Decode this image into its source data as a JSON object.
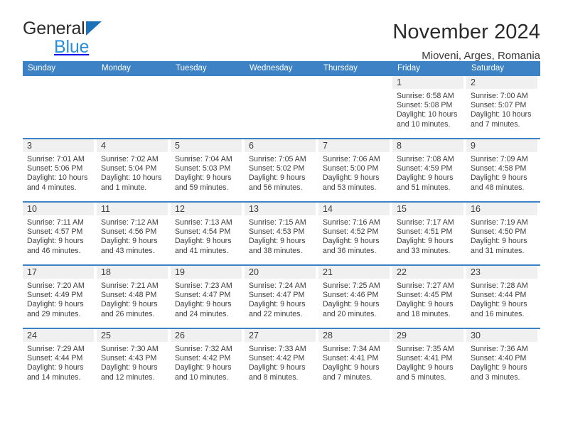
{
  "brand": {
    "name_part1": "General",
    "name_part2": "Blue",
    "logo_icon": "triangle-logo-icon"
  },
  "header": {
    "title": "November 2024",
    "subtitle": "Mioveni, Arges, Romania"
  },
  "calendar": {
    "weekday_headers": [
      "Sunday",
      "Monday",
      "Tuesday",
      "Wednesday",
      "Thursday",
      "Friday",
      "Saturday"
    ],
    "colors": {
      "header_blue": "#3c82c4",
      "daynum_band": "#f0f0f0",
      "brand_blue": "#2a8fd8",
      "logo_blue": "#1b72b8"
    },
    "weeks": [
      [
        {
          "day": "",
          "lines": []
        },
        {
          "day": "",
          "lines": []
        },
        {
          "day": "",
          "lines": []
        },
        {
          "day": "",
          "lines": []
        },
        {
          "day": "",
          "lines": []
        },
        {
          "day": "1",
          "lines": [
            "Sunrise: 6:58 AM",
            "Sunset: 5:08 PM",
            "Daylight: 10 hours",
            "and 10 minutes."
          ]
        },
        {
          "day": "2",
          "lines": [
            "Sunrise: 7:00 AM",
            "Sunset: 5:07 PM",
            "Daylight: 10 hours",
            "and 7 minutes."
          ]
        }
      ],
      [
        {
          "day": "3",
          "lines": [
            "Sunrise: 7:01 AM",
            "Sunset: 5:06 PM",
            "Daylight: 10 hours",
            "and 4 minutes."
          ]
        },
        {
          "day": "4",
          "lines": [
            "Sunrise: 7:02 AM",
            "Sunset: 5:04 PM",
            "Daylight: 10 hours",
            "and 1 minute."
          ]
        },
        {
          "day": "5",
          "lines": [
            "Sunrise: 7:04 AM",
            "Sunset: 5:03 PM",
            "Daylight: 9 hours",
            "and 59 minutes."
          ]
        },
        {
          "day": "6",
          "lines": [
            "Sunrise: 7:05 AM",
            "Sunset: 5:02 PM",
            "Daylight: 9 hours",
            "and 56 minutes."
          ]
        },
        {
          "day": "7",
          "lines": [
            "Sunrise: 7:06 AM",
            "Sunset: 5:00 PM",
            "Daylight: 9 hours",
            "and 53 minutes."
          ]
        },
        {
          "day": "8",
          "lines": [
            "Sunrise: 7:08 AM",
            "Sunset: 4:59 PM",
            "Daylight: 9 hours",
            "and 51 minutes."
          ]
        },
        {
          "day": "9",
          "lines": [
            "Sunrise: 7:09 AM",
            "Sunset: 4:58 PM",
            "Daylight: 9 hours",
            "and 48 minutes."
          ]
        }
      ],
      [
        {
          "day": "10",
          "lines": [
            "Sunrise: 7:11 AM",
            "Sunset: 4:57 PM",
            "Daylight: 9 hours",
            "and 46 minutes."
          ]
        },
        {
          "day": "11",
          "lines": [
            "Sunrise: 7:12 AM",
            "Sunset: 4:56 PM",
            "Daylight: 9 hours",
            "and 43 minutes."
          ]
        },
        {
          "day": "12",
          "lines": [
            "Sunrise: 7:13 AM",
            "Sunset: 4:54 PM",
            "Daylight: 9 hours",
            "and 41 minutes."
          ]
        },
        {
          "day": "13",
          "lines": [
            "Sunrise: 7:15 AM",
            "Sunset: 4:53 PM",
            "Daylight: 9 hours",
            "and 38 minutes."
          ]
        },
        {
          "day": "14",
          "lines": [
            "Sunrise: 7:16 AM",
            "Sunset: 4:52 PM",
            "Daylight: 9 hours",
            "and 36 minutes."
          ]
        },
        {
          "day": "15",
          "lines": [
            "Sunrise: 7:17 AM",
            "Sunset: 4:51 PM",
            "Daylight: 9 hours",
            "and 33 minutes."
          ]
        },
        {
          "day": "16",
          "lines": [
            "Sunrise: 7:19 AM",
            "Sunset: 4:50 PM",
            "Daylight: 9 hours",
            "and 31 minutes."
          ]
        }
      ],
      [
        {
          "day": "17",
          "lines": [
            "Sunrise: 7:20 AM",
            "Sunset: 4:49 PM",
            "Daylight: 9 hours",
            "and 29 minutes."
          ]
        },
        {
          "day": "18",
          "lines": [
            "Sunrise: 7:21 AM",
            "Sunset: 4:48 PM",
            "Daylight: 9 hours",
            "and 26 minutes."
          ]
        },
        {
          "day": "19",
          "lines": [
            "Sunrise: 7:23 AM",
            "Sunset: 4:47 PM",
            "Daylight: 9 hours",
            "and 24 minutes."
          ]
        },
        {
          "day": "20",
          "lines": [
            "Sunrise: 7:24 AM",
            "Sunset: 4:47 PM",
            "Daylight: 9 hours",
            "and 22 minutes."
          ]
        },
        {
          "day": "21",
          "lines": [
            "Sunrise: 7:25 AM",
            "Sunset: 4:46 PM",
            "Daylight: 9 hours",
            "and 20 minutes."
          ]
        },
        {
          "day": "22",
          "lines": [
            "Sunrise: 7:27 AM",
            "Sunset: 4:45 PM",
            "Daylight: 9 hours",
            "and 18 minutes."
          ]
        },
        {
          "day": "23",
          "lines": [
            "Sunrise: 7:28 AM",
            "Sunset: 4:44 PM",
            "Daylight: 9 hours",
            "and 16 minutes."
          ]
        }
      ],
      [
        {
          "day": "24",
          "lines": [
            "Sunrise: 7:29 AM",
            "Sunset: 4:44 PM",
            "Daylight: 9 hours",
            "and 14 minutes."
          ]
        },
        {
          "day": "25",
          "lines": [
            "Sunrise: 7:30 AM",
            "Sunset: 4:43 PM",
            "Daylight: 9 hours",
            "and 12 minutes."
          ]
        },
        {
          "day": "26",
          "lines": [
            "Sunrise: 7:32 AM",
            "Sunset: 4:42 PM",
            "Daylight: 9 hours",
            "and 10 minutes."
          ]
        },
        {
          "day": "27",
          "lines": [
            "Sunrise: 7:33 AM",
            "Sunset: 4:42 PM",
            "Daylight: 9 hours",
            "and 8 minutes."
          ]
        },
        {
          "day": "28",
          "lines": [
            "Sunrise: 7:34 AM",
            "Sunset: 4:41 PM",
            "Daylight: 9 hours",
            "and 7 minutes."
          ]
        },
        {
          "day": "29",
          "lines": [
            "Sunrise: 7:35 AM",
            "Sunset: 4:41 PM",
            "Daylight: 9 hours",
            "and 5 minutes."
          ]
        },
        {
          "day": "30",
          "lines": [
            "Sunrise: 7:36 AM",
            "Sunset: 4:40 PM",
            "Daylight: 9 hours",
            "and 3 minutes."
          ]
        }
      ]
    ]
  }
}
